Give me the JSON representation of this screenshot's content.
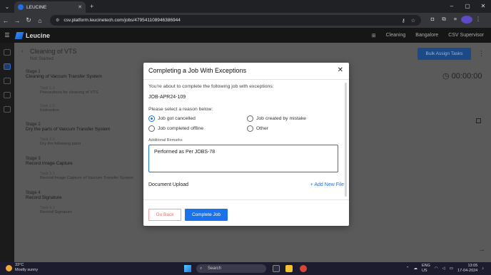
{
  "browser": {
    "tab_title": "LEUCINE",
    "url": "csv.platform.leucinetech.com/jobs/479541108946386944"
  },
  "app": {
    "brand": "Leucine",
    "use_case": "Cleaning",
    "facility": "Bangalore",
    "user_role": "CSV Supervisor"
  },
  "job": {
    "title": "Cleaning of VTS",
    "status": "Not Started",
    "bulk_assign_label": "Bulk Assign Tasks",
    "timer": "00:00:00"
  },
  "stages": [
    {
      "label": "Stage 1",
      "name": "Cleaning of Vaccum Transfer System",
      "tasks": [
        {
          "num": "Task 1.1",
          "name": "Precautions for cleaning of VTS"
        },
        {
          "num": "Task 1.2",
          "name": "Instruction"
        }
      ]
    },
    {
      "label": "Stage 2",
      "name": "Dry the parts of Vaccum Transfer System",
      "tasks": [
        {
          "num": "Task 2.1",
          "name": "Dry the following parts"
        }
      ]
    },
    {
      "label": "Stage 3",
      "name": "Record Image Capture",
      "tasks": [
        {
          "num": "Task 3.1",
          "name": "Record Image Capture of Vaccum Transfer System"
        }
      ]
    },
    {
      "label": "Stage 4",
      "name": "Record Signature",
      "tasks": [
        {
          "num": "Task 4.1",
          "name": "Record Signature"
        }
      ]
    }
  ],
  "modal": {
    "title": "Completing a Job With Exceptions",
    "intro": "You're about to complete the following job with exceptions:",
    "job_id": "JOB-APR24-109",
    "reason_prompt": "Please select a reason below:",
    "reasons": [
      {
        "label": "Job got cancelled",
        "selected": true
      },
      {
        "label": "Job created by mistake",
        "selected": false
      },
      {
        "label": "Job completed offline",
        "selected": false
      },
      {
        "label": "Other",
        "selected": false
      }
    ],
    "remarks_label": "Additional Remarks",
    "remarks_value": "Performed as Per JOBS-78",
    "upload_label": "Document Upload",
    "add_file_label": "Add New File",
    "back_label": "Go Back",
    "complete_label": "Complete Job"
  },
  "taskbar": {
    "temperature": "33°C",
    "weather": "Mostly sunny",
    "search_placeholder": "Search",
    "lang1": "ENG",
    "lang2": "US",
    "time": "13:05",
    "date": "17-04-2024"
  },
  "colors": {
    "primary": "#1a73e8",
    "danger": "#e07070",
    "overlay": "#5a5a5a"
  }
}
